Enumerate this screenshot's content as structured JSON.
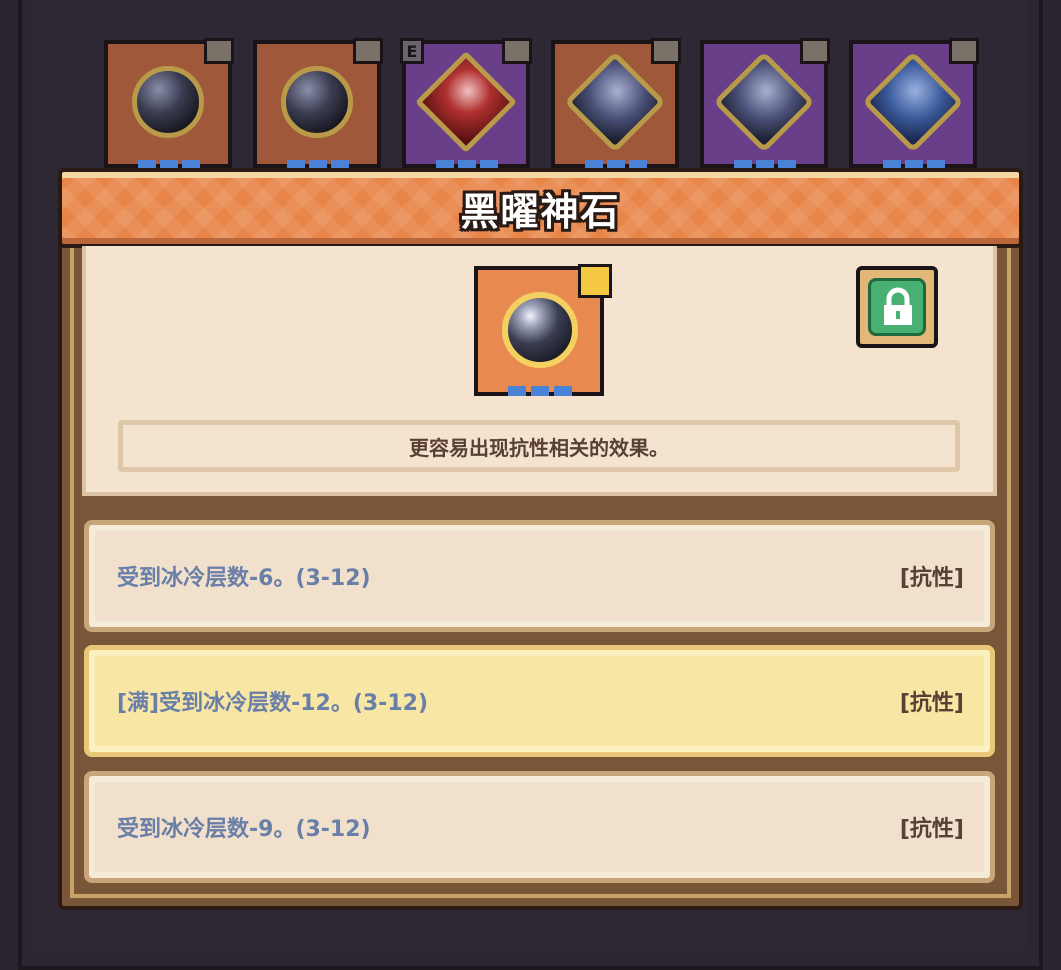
{
  "dialog": {
    "title": "黑曜神石",
    "description": "更容易出现抗性相关的效果。"
  },
  "inventory": {
    "slots": [
      {
        "gem": "obsidian-orb",
        "color": "#a0583a",
        "locked": true
      },
      {
        "gem": "obsidian-orb",
        "color": "#a0583a",
        "locked": true
      },
      {
        "gem": "red-diamond",
        "color": "#6a3f8a",
        "locked": true,
        "badge": "E"
      },
      {
        "gem": "sapphire-diamond",
        "color": "#a0583a",
        "locked": true
      },
      {
        "gem": "sapphire-diamond",
        "color": "#6a3f8a",
        "locked": true
      },
      {
        "gem": "blue-diamond",
        "color": "#6a3f8a",
        "locked": true
      }
    ]
  },
  "affixes": [
    {
      "text": "受到冰冷层数-6。(3-12)",
      "tag": "[抗性]",
      "maxed": false
    },
    {
      "text": "[满]受到冰冷层数-12。(3-12)",
      "tag": "[抗性]",
      "maxed": true
    },
    {
      "text": "受到冰冷层数-9。(3-12)",
      "tag": "[抗性]",
      "maxed": false
    }
  ],
  "colors": {
    "title_bar": "#e8864a",
    "panel": "#f3e3cf",
    "affix_text": "#6a7fa8",
    "maxed_highlight": "#f8e6a4",
    "lock_button": "#48b070"
  }
}
